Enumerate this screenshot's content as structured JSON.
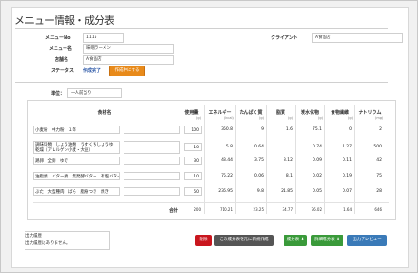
{
  "page": {
    "title": "メニュー情報・成分表"
  },
  "header": {
    "menu_no_label": "メニューNo",
    "menu_no": "1115",
    "client_label": "クライアント",
    "client": "A食品店",
    "menu_name_label": "メニュー名",
    "menu_name": "味噌ラーメン",
    "store_label": "店舗名",
    "store": "A食品店",
    "status_label": "ステータス",
    "status": "作成完了",
    "create_button": "作成中にする"
  },
  "unit": {
    "label": "単位：",
    "value": "一人前当り"
  },
  "table": {
    "headers": {
      "food": "食材名",
      "amount": "使用量",
      "energy": "エネルギー",
      "protein": "たんぱく質",
      "fat": "脂質",
      "carb": "炭水化物",
      "fiber": "食物繊維",
      "sodium": "ナトリウム"
    },
    "units": {
      "amount": "(g)",
      "energy": "(kcal)",
      "protein": "(g)",
      "fat": "(g)",
      "carb": "(g)",
      "fiber": "(g)",
      "sodium": "(mg)"
    },
    "rows": [
      {
        "food": "小麦粉　中力粉　１等",
        "amount": "100",
        "energy": "350.8",
        "protein": "9",
        "fat": "1.6",
        "carb": "75.1",
        "fiber": "0",
        "sodium": "2"
      },
      {
        "food": "調味料類　しょう油類　うすくちしょうゆ 乾燥（アレルゲン小麦・大豆）",
        "amount": "10",
        "energy": "5.8",
        "protein": "0.64",
        "fat": "",
        "carb": "0.74",
        "fiber": "1.27",
        "sodium": "500"
      },
      {
        "food": "鶏卵　全卵　ゆで",
        "amount": "30",
        "energy": "43.44",
        "protein": "3.75",
        "fat": "3.12",
        "carb": "0.09",
        "fiber": "0.11",
        "sodium": "42"
      },
      {
        "food": "油脂類　バター類　無発酵バター　有塩バター",
        "amount": "10",
        "energy": "75.22",
        "protein": "0.06",
        "fat": "8.1",
        "carb": "0.02",
        "fiber": "0.19",
        "sodium": "75"
      },
      {
        "food": "ぶた　大型種肉　ばら　脂身つき　焼き",
        "amount": "50",
        "energy": "236.95",
        "protein": "9.8",
        "fat": "21.85",
        "carb": "0.05",
        "fiber": "0.07",
        "sodium": "28"
      }
    ],
    "total": {
      "label": "合計",
      "amount": "200",
      "energy": "710.21",
      "protein": "23.25",
      "fat": "34.77",
      "carb": "76.02",
      "fiber": "1.64",
      "sodium": "646"
    }
  },
  "history": {
    "title": "出力履歴",
    "empty": "出力履歴はありません。"
  },
  "actions": {
    "delete": "削除",
    "copy_create": "この成分表を元に新規作成",
    "save": "成分表 ⬇",
    "detail_save": "詳細成分表 ⬇",
    "preview": "出力プレビュー"
  }
}
